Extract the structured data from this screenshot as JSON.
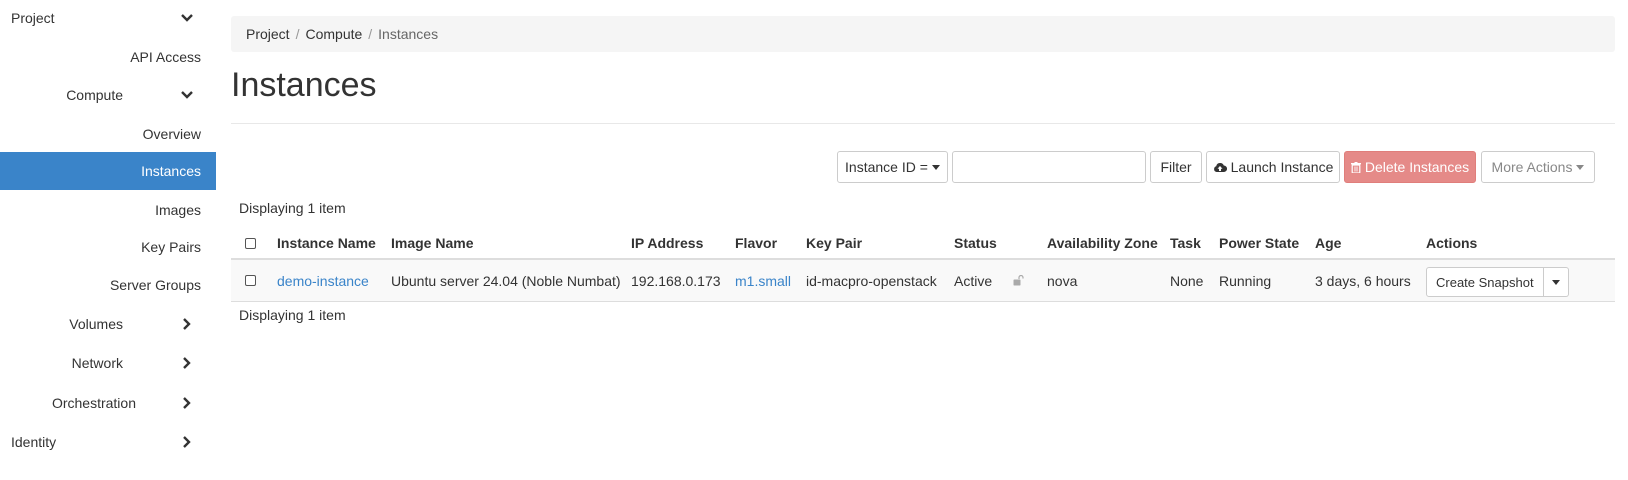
{
  "sidebar": {
    "project_label": "Project",
    "api_access_label": "API Access",
    "compute_label": "Compute",
    "compute_items": [
      "Overview",
      "Instances",
      "Images",
      "Key Pairs",
      "Server Groups"
    ],
    "volumes_label": "Volumes",
    "network_label": "Network",
    "orchestration_label": "Orchestration",
    "identity_label": "Identity",
    "active_item": "Instances",
    "active_color": "#3a84c9"
  },
  "breadcrumb": {
    "items": [
      "Project",
      "Compute",
      "Instances"
    ],
    "separator": "/"
  },
  "page": {
    "title": "Instances"
  },
  "toolbar": {
    "filter_field_label": "Instance ID =",
    "search_value": "",
    "filter_button": "Filter",
    "launch_button": "Launch Instance",
    "delete_button": "Delete Instances",
    "more_actions_button": "More Actions",
    "danger_color": "#e58a88"
  },
  "table": {
    "count_text": "Displaying 1 item",
    "columns": [
      "Instance Name",
      "Image Name",
      "IP Address",
      "Flavor",
      "Key Pair",
      "Status",
      "Availability Zone",
      "Task",
      "Power State",
      "Age",
      "Actions"
    ],
    "rows": [
      {
        "instance_name": "demo-instance",
        "image_name": "Ubuntu server 24.04 (Noble Numbat)",
        "ip_address": "192.168.0.173",
        "flavor": "m1.small",
        "key_pair": "id-macpro-openstack",
        "status": "Active",
        "lock_icon": "unlock-icon",
        "availability_zone": "nova",
        "task": "None",
        "power_state": "Running",
        "age": "3 days, 6 hours",
        "action_label": "Create Snapshot"
      }
    ]
  }
}
